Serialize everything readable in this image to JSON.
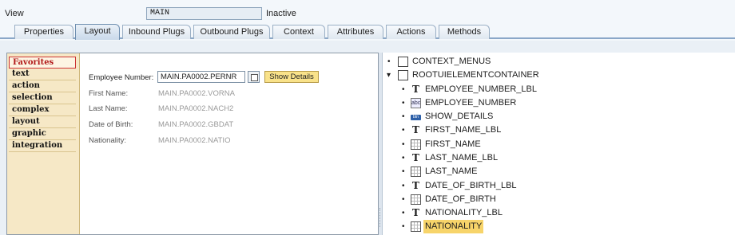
{
  "view": {
    "label": "View",
    "value": "MAIN",
    "status": "Inactive"
  },
  "tabs": [
    {
      "label": "Properties",
      "active": false
    },
    {
      "label": "Layout",
      "active": true
    },
    {
      "label": "Inbound Plugs",
      "active": false
    },
    {
      "label": "Outbound Plugs",
      "active": false
    },
    {
      "label": "Context",
      "active": false
    },
    {
      "label": "Attributes",
      "active": false
    },
    {
      "label": "Actions",
      "active": false
    },
    {
      "label": "Methods",
      "active": false
    }
  ],
  "palette": {
    "items": [
      {
        "label": "Favorites",
        "active": true
      },
      {
        "label": "text"
      },
      {
        "label": "action"
      },
      {
        "label": "selection"
      },
      {
        "label": "complex"
      },
      {
        "label": "layout"
      },
      {
        "label": "graphic"
      },
      {
        "label": "integration"
      }
    ]
  },
  "form": {
    "employee_label": "Employee Number:",
    "employee_value": "MAIN.PA0002.PERNR",
    "show_details": "Show Details",
    "fields": [
      {
        "label": "First Name:",
        "value": "MAIN.PA0002.VORNA"
      },
      {
        "label": "Last Name:",
        "value": "MAIN.PA0002.NACH2"
      },
      {
        "label": "Date of Birth:",
        "value": "MAIN.PA0002.GBDAT"
      },
      {
        "label": "Nationality:",
        "value": "MAIN.PA0002.NATIO"
      }
    ]
  },
  "tree": {
    "nodes": [
      {
        "label": "CONTEXT_MENUS",
        "icon": "box-icon",
        "bullet": "•"
      },
      {
        "label": "ROOTUIELEMENTCONTAINER",
        "icon": "box-icon",
        "bullet": "▾"
      },
      {
        "label": "EMPLOYEE_NUMBER_LBL",
        "icon": "label-icon",
        "bullet": "•"
      },
      {
        "label": "EMPLOYEE_NUMBER",
        "icon": "input-field-icon",
        "bullet": "•"
      },
      {
        "label": "SHOW_DETAILS",
        "icon": "button-icon",
        "bullet": "•"
      },
      {
        "label": "FIRST_NAME_LBL",
        "icon": "label-icon",
        "bullet": "•"
      },
      {
        "label": "FIRST_NAME",
        "icon": "grid-icon",
        "bullet": "•"
      },
      {
        "label": "LAST_NAME_LBL",
        "icon": "label-icon",
        "bullet": "•"
      },
      {
        "label": "LAST_NAME",
        "icon": "grid-icon",
        "bullet": "•"
      },
      {
        "label": "DATE_OF_BIRTH_LBL",
        "icon": "label-icon",
        "bullet": "•"
      },
      {
        "label": "DATE_OF_BIRTH",
        "icon": "grid-icon",
        "bullet": "•"
      },
      {
        "label": "NATIONALITY_LBL",
        "icon": "label-icon",
        "bullet": "•"
      },
      {
        "label": "NATIONALITY",
        "icon": "grid-icon",
        "bullet": "•",
        "selected": true
      }
    ]
  },
  "colors": {
    "selection": "#f7d46a",
    "palette_bg": "#f6e8c6",
    "show_details_bg": "#f9e28a"
  }
}
